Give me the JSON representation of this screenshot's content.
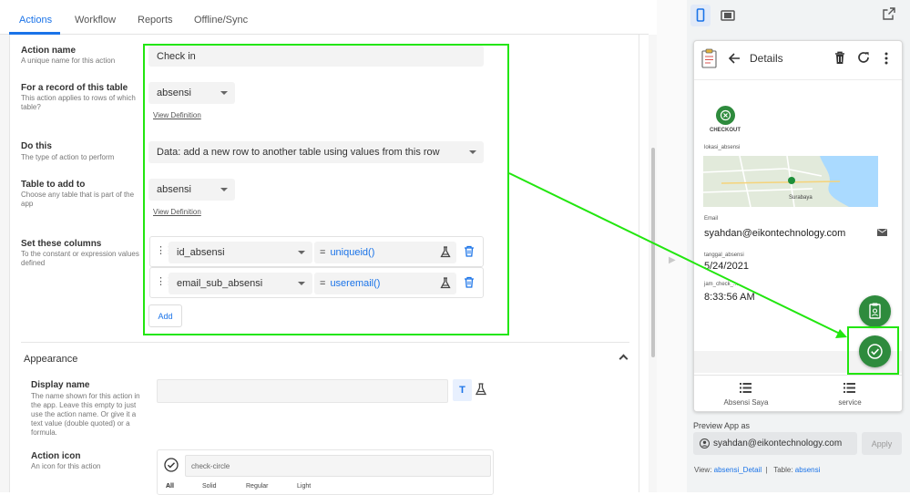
{
  "tabs": [
    "Actions",
    "Workflow",
    "Reports",
    "Offline/Sync"
  ],
  "editor": {
    "action_name": {
      "label": "Action name",
      "desc": "A unique name for this action",
      "value": "Check in"
    },
    "for_record": {
      "label": "For a record of this table",
      "desc": "This action applies to rows of which table?",
      "value": "absensi",
      "link": "View Definition"
    },
    "do_this": {
      "label": "Do this",
      "desc": "The type of action to perform",
      "value": "Data: add a new row to another table using values from this row"
    },
    "table_to_add": {
      "label": "Table to add to",
      "desc": "Choose any table that is part of the app",
      "value": "absensi",
      "link": "View Definition"
    },
    "set_columns": {
      "label": "Set these columns",
      "desc": "To the constant or expression values defined",
      "rows": [
        {
          "column": "id_absensi",
          "eq": "=",
          "expr": "uniqueid()"
        },
        {
          "column": "email_sub_absensi",
          "eq": "=",
          "expr": "useremail()"
        }
      ],
      "add_label": "Add"
    },
    "appearance": {
      "title": "Appearance",
      "display_name": {
        "label": "Display name",
        "desc": "The name shown for this action in the app. Leave this empty to just use the action name. Or give it a text value (double quoted) or a formula.",
        "value": "",
        "t_label": "T"
      },
      "action_icon": {
        "label": "Action icon",
        "desc": "An icon for this action",
        "value": "check-circle",
        "tabs": [
          "All",
          "Solid",
          "Regular",
          "Light"
        ]
      }
    }
  },
  "preview": {
    "header_title": "Details",
    "checkout_label": "CHECKOUT",
    "fields": [
      {
        "label": "lokasi_absensi",
        "value": ""
      },
      {
        "label": "Email",
        "value": "syahdan@eikontechnology.com"
      },
      {
        "label": "tanggal_absensi",
        "value": "5/24/2021"
      },
      {
        "label": "jam_check_...",
        "value": "8:33:56 AM"
      }
    ],
    "map_labels": [
      "Surabaya"
    ],
    "nav": [
      "Absensi Saya",
      "service"
    ],
    "preview_as_label": "Preview App as",
    "preview_as_value": "syahdan@eikontechnology.com",
    "apply_label": "Apply",
    "view_prefix": "View:",
    "view_name": "absensi_Detail",
    "table_prefix": "Table:",
    "table_name": "absensi"
  },
  "colors": {
    "accent": "#1a73e8",
    "highlight": "#22e60f",
    "app_green": "#2e8b3d"
  },
  "icons": [
    "drag-handle-icon",
    "flask-icon",
    "trash-icon",
    "chevron-up-icon",
    "check-circle-icon",
    "back-arrow-icon",
    "refresh-icon",
    "more-vert-icon",
    "clipboard-icon",
    "mail-icon",
    "list-icon",
    "account-icon",
    "mobile-icon",
    "tablet-icon",
    "open-new-icon"
  ]
}
